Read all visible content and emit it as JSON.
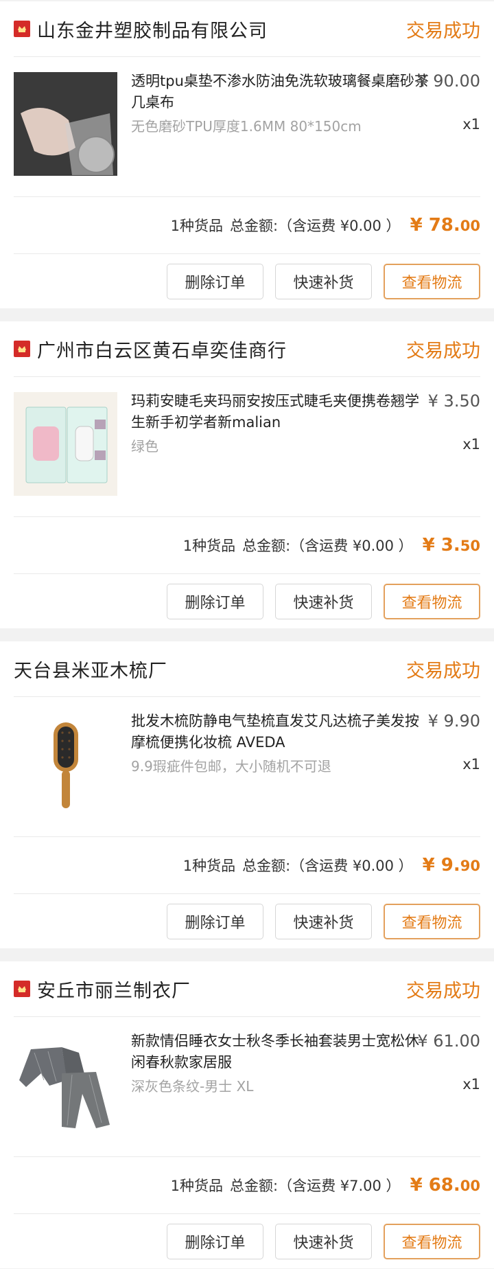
{
  "orders": [
    {
      "shop": "山东金井塑胶制品有限公司",
      "shop_badge": true,
      "status": "交易成功",
      "item": {
        "title": "透明tpu桌垫不渗水防油免洗软玻璃餐桌磨砂茶几桌布",
        "spec": "无色磨砂TPU厚度1.6MM 80*150cm",
        "price": "¥ 90.00",
        "qty": "x1"
      },
      "summary": {
        "count": "1种货品",
        "label": "总金额:（含运费 ¥0.00 ）",
        "total_int": "¥ 78.",
        "total_dec": "00"
      },
      "buttons": [
        "删除订单",
        "快速补货",
        "查看物流"
      ]
    },
    {
      "shop": "广州市白云区黄石卓奕佳商行",
      "shop_badge": true,
      "status": "交易成功",
      "item": {
        "title": "玛莉安睫毛夹玛丽安按压式睫毛夹便携卷翘学生新手初学者新malian",
        "spec": "绿色",
        "price": "¥ 3.50",
        "qty": "x1"
      },
      "summary": {
        "count": "1种货品",
        "label": "总金额:（含运费 ¥0.00 ）",
        "total_int": "¥ 3.",
        "total_dec": "50"
      },
      "buttons": [
        "删除订单",
        "快速补货",
        "查看物流"
      ]
    },
    {
      "shop": "天台县米亚木梳厂",
      "shop_badge": false,
      "status": "交易成功",
      "item": {
        "title": "批发木梳防静电气垫梳直发艾凡达梳子美发按摩梳便携化妆梳 AVEDA",
        "spec": "9.9瑕疵件包邮，大小随机不可退",
        "price": "¥ 9.90",
        "qty": "x1"
      },
      "summary": {
        "count": "1种货品",
        "label": "总金额:（含运费 ¥0.00 ）",
        "total_int": "¥ 9.",
        "total_dec": "90"
      },
      "buttons": [
        "删除订单",
        "快速补货",
        "查看物流"
      ]
    },
    {
      "shop": "安丘市丽兰制衣厂",
      "shop_badge": true,
      "status": "交易成功",
      "item": {
        "title": "新款情侣睡衣女士秋冬季长袖套装男士宽松休闲春秋款家居服",
        "spec": "深灰色条纹-男士 XL",
        "price": "¥ 61.00",
        "qty": "x1"
      },
      "summary": {
        "count": "1种货品",
        "label": "总金额:（含运费 ¥7.00 ）",
        "total_int": "¥ 68.",
        "total_dec": "00"
      },
      "buttons": [
        "删除订单",
        "快速补货",
        "查看物流"
      ]
    }
  ],
  "colors": {
    "accent": "#e37b16",
    "badge": "#d42b28"
  },
  "icons": {
    "shop_badge": "shop-badge-icon"
  }
}
